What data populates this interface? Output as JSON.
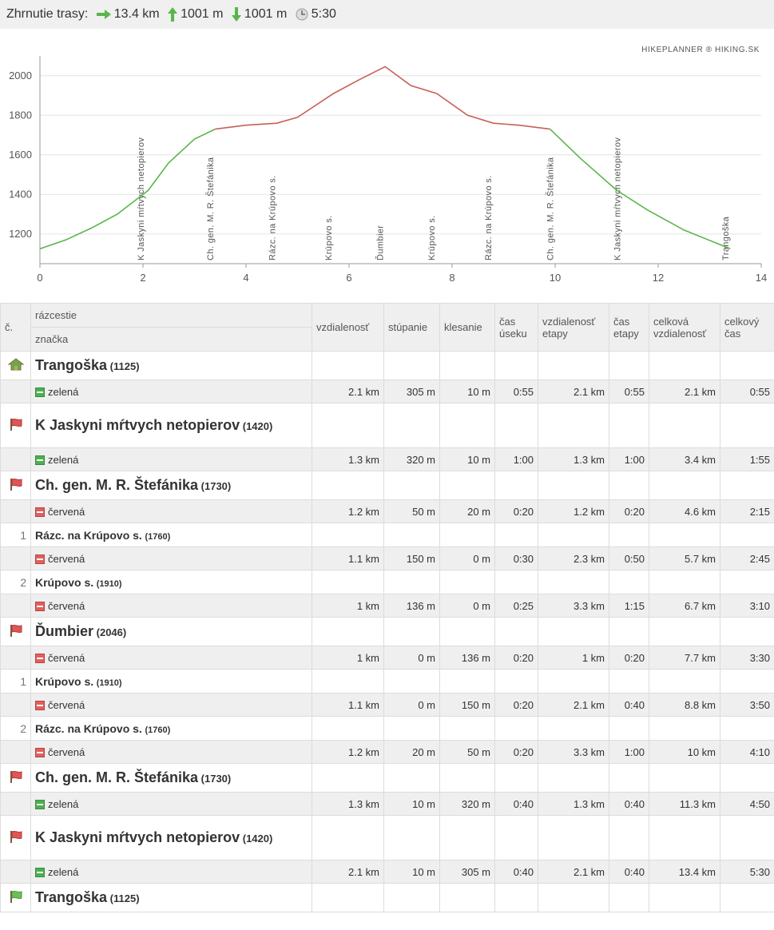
{
  "summary": {
    "label": "Zhrnutie trasy:",
    "distance": "13.4 km",
    "ascent": "1001 m",
    "descent": "1001 m",
    "time": "5:30"
  },
  "credit": "HIKEPLANNER ® HIKING.SK",
  "colors": {
    "ascent_green": "#5ab54b",
    "descent_red": "#c86055",
    "route_green": "#4caf50",
    "route_red": "#e06060"
  },
  "chart_data": {
    "type": "line",
    "xlim": [
      0,
      14
    ],
    "ylim": [
      1050,
      2100
    ],
    "xticks": [
      "0",
      "2",
      "4",
      "6",
      "8",
      "10",
      "12",
      "14"
    ],
    "yticks": [
      "1200",
      "1400",
      "1600",
      "1800",
      "2000"
    ],
    "series": [
      {
        "color": "#5ab54b",
        "points": [
          [
            0,
            1125
          ],
          [
            0.5,
            1170
          ],
          [
            1,
            1230
          ],
          [
            1.5,
            1300
          ],
          [
            2.1,
            1420
          ],
          [
            2.5,
            1560
          ],
          [
            3,
            1680
          ],
          [
            3.4,
            1730
          ]
        ]
      },
      {
        "color": "#c86055",
        "points": [
          [
            3.4,
            1730
          ],
          [
            4,
            1750
          ],
          [
            4.6,
            1760
          ],
          [
            5,
            1790
          ],
          [
            5.7,
            1910
          ],
          [
            6.2,
            1980
          ],
          [
            6.7,
            2046
          ],
          [
            7.2,
            1950
          ],
          [
            7.7,
            1910
          ],
          [
            8.3,
            1800
          ],
          [
            8.8,
            1760
          ],
          [
            9.3,
            1750
          ],
          [
            9.9,
            1730
          ]
        ]
      },
      {
        "color": "#5ab54b",
        "points": [
          [
            9.9,
            1730
          ],
          [
            10.5,
            1580
          ],
          [
            11.2,
            1420
          ],
          [
            11.8,
            1320
          ],
          [
            12.5,
            1220
          ],
          [
            13.4,
            1125
          ]
        ]
      }
    ],
    "annotations": [
      {
        "x": 1.95,
        "label": "K Jaskyni mŕtvych netopierov"
      },
      {
        "x": 3.3,
        "label": "Ch. gen. M. R. Štefánika"
      },
      {
        "x": 4.5,
        "label": "Rázc. na Krúpovo s."
      },
      {
        "x": 5.6,
        "label": "Krúpovo s."
      },
      {
        "x": 6.6,
        "label": "Ďumbier"
      },
      {
        "x": 7.6,
        "label": "Krúpovo s."
      },
      {
        "x": 8.7,
        "label": "Rázc. na Krúpovo s."
      },
      {
        "x": 9.9,
        "label": "Ch. gen. M. R. Štefánika"
      },
      {
        "x": 11.2,
        "label": "K Jaskyni mŕtvych netopierov"
      },
      {
        "x": 13.3,
        "label": "Trangoška"
      }
    ]
  },
  "table": {
    "header": {
      "c": "č.",
      "razcestie": "rázcestie",
      "znacka": "značka",
      "cols": [
        "vzdialenosť",
        "stúpanie",
        "klesanie",
        "čas úseku",
        "vzdialenosť etapy",
        "čas etapy",
        "celková vzdialenosť",
        "celkový čas"
      ]
    },
    "rows": [
      {
        "t": "poi",
        "icon": "home",
        "name": "Trangoška",
        "alt": "(1125)"
      },
      {
        "t": "seg",
        "mark": "green",
        "label": "zelená",
        "v": [
          "2.1 km",
          "305 m",
          "10 m",
          "0:55",
          "2.1 km",
          "0:55",
          "2.1 km",
          "0:55"
        ]
      },
      {
        "t": "poi",
        "icon": "red",
        "name": "K Jaskyni mŕtvych netopierov",
        "alt": "(1420)",
        "tall": true
      },
      {
        "t": "seg",
        "mark": "green",
        "label": "zelená",
        "v": [
          "1.3 km",
          "320 m",
          "10 m",
          "1:00",
          "1.3 km",
          "1:00",
          "3.4 km",
          "1:55"
        ]
      },
      {
        "t": "poi",
        "icon": "red",
        "name": "Ch. gen. M. R. Štefánika",
        "alt": "(1730)"
      },
      {
        "t": "seg",
        "mark": "red",
        "label": "červená",
        "v": [
          "1.2 km",
          "50 m",
          "20 m",
          "0:20",
          "1.2 km",
          "0:20",
          "4.6 km",
          "2:15"
        ]
      },
      {
        "t": "wp",
        "idx": "1",
        "name": "Rázc. na Krúpovo s.",
        "alt": "(1760)"
      },
      {
        "t": "seg",
        "mark": "red",
        "label": "červená",
        "v": [
          "1.1 km",
          "150 m",
          "0 m",
          "0:30",
          "2.3 km",
          "0:50",
          "5.7 km",
          "2:45"
        ]
      },
      {
        "t": "wp",
        "idx": "2",
        "name": "Krúpovo s.",
        "alt": "(1910)"
      },
      {
        "t": "seg",
        "mark": "red",
        "label": "červená",
        "v": [
          "1 km",
          "136 m",
          "0 m",
          "0:25",
          "3.3 km",
          "1:15",
          "6.7 km",
          "3:10"
        ]
      },
      {
        "t": "poi",
        "icon": "red",
        "name": "Ďumbier",
        "alt": "(2046)"
      },
      {
        "t": "seg",
        "mark": "red",
        "label": "červená",
        "v": [
          "1 km",
          "0 m",
          "136 m",
          "0:20",
          "1 km",
          "0:20",
          "7.7 km",
          "3:30"
        ]
      },
      {
        "t": "wp",
        "idx": "1",
        "name": "Krúpovo s.",
        "alt": "(1910)"
      },
      {
        "t": "seg",
        "mark": "red",
        "label": "červená",
        "v": [
          "1.1 km",
          "0 m",
          "150 m",
          "0:20",
          "2.1 km",
          "0:40",
          "8.8 km",
          "3:50"
        ]
      },
      {
        "t": "wp",
        "idx": "2",
        "name": "Rázc. na Krúpovo s.",
        "alt": "(1760)"
      },
      {
        "t": "seg",
        "mark": "red",
        "label": "červená",
        "v": [
          "1.2 km",
          "20 m",
          "50 m",
          "0:20",
          "3.3 km",
          "1:00",
          "10 km",
          "4:10"
        ]
      },
      {
        "t": "poi",
        "icon": "red",
        "name": "Ch. gen. M. R. Štefánika",
        "alt": "(1730)"
      },
      {
        "t": "seg",
        "mark": "green",
        "label": "zelená",
        "v": [
          "1.3 km",
          "10 m",
          "320 m",
          "0:40",
          "1.3 km",
          "0:40",
          "11.3 km",
          "4:50"
        ]
      },
      {
        "t": "poi",
        "icon": "red",
        "name": "K Jaskyni mŕtvych netopierov",
        "alt": "(1420)",
        "tall": true
      },
      {
        "t": "seg",
        "mark": "green",
        "label": "zelená",
        "v": [
          "2.1 km",
          "10 m",
          "305 m",
          "0:40",
          "2.1 km",
          "0:40",
          "13.4 km",
          "5:30"
        ]
      },
      {
        "t": "poi",
        "icon": "green",
        "name": "Trangoška",
        "alt": "(1125)"
      }
    ]
  }
}
